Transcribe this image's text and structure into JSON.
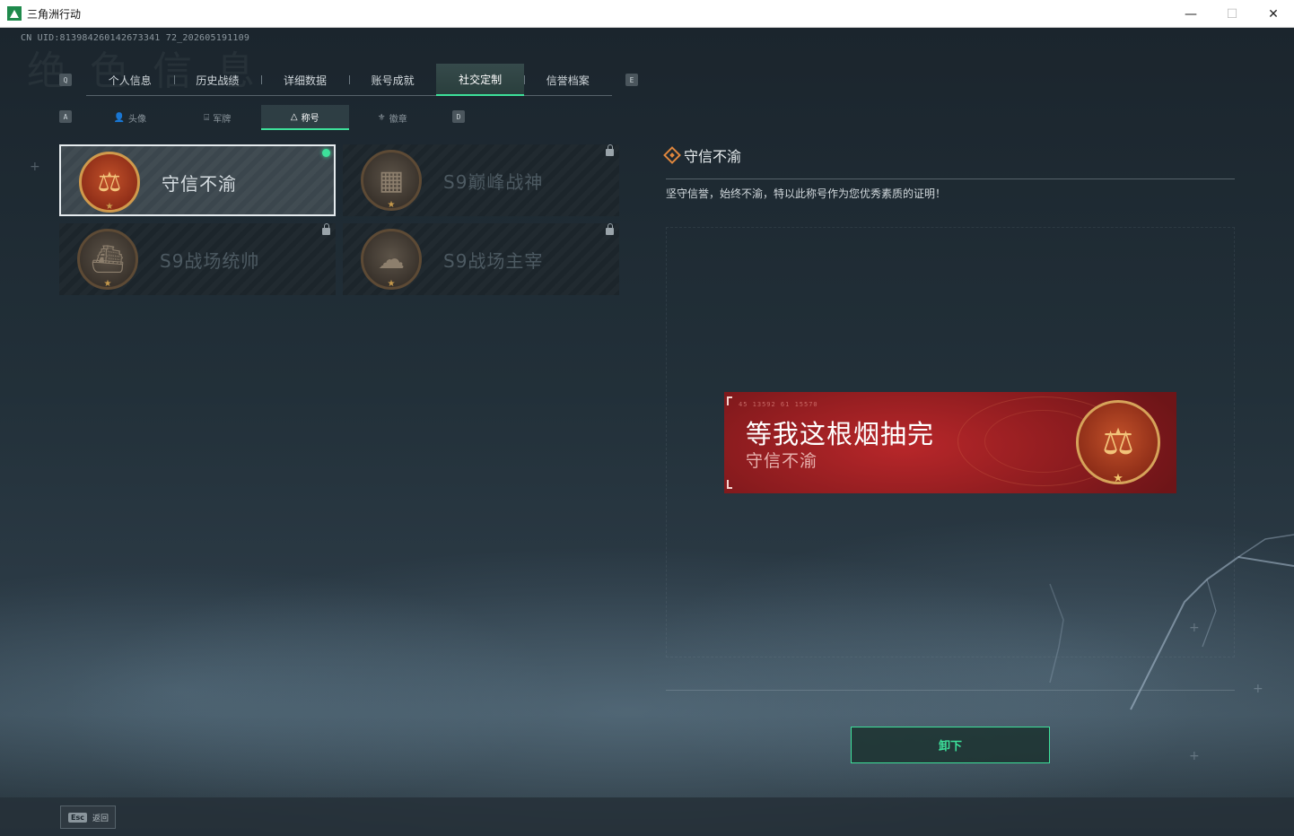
{
  "window": {
    "title": "三角洲行动",
    "minimize": "—",
    "maximize": "☐",
    "close": "✕"
  },
  "header": {
    "uid": "CN UID:813984260142673341 72_202605191109",
    "watermark": "绝 色 信 息"
  },
  "main_tabs": {
    "left_key": "Q",
    "right_key": "E",
    "items": [
      {
        "label": "个人信息"
      },
      {
        "label": "历史战绩"
      },
      {
        "label": "详细数据"
      },
      {
        "label": "账号成就"
      },
      {
        "label": "社交定制",
        "active": true
      },
      {
        "label": "信誉档案"
      }
    ]
  },
  "sub_tabs": {
    "left_key": "A",
    "right_key": "D",
    "items": [
      {
        "label": "头像",
        "icon": "person-icon",
        "glyph": "👤"
      },
      {
        "label": "军牌",
        "icon": "dogtag-icon",
        "glyph": "⌸"
      },
      {
        "label": "称号",
        "icon": "title-icon",
        "glyph": "△",
        "active": true
      },
      {
        "label": "徽章",
        "icon": "badge-icon",
        "glyph": "⚜"
      }
    ]
  },
  "titles": [
    {
      "name": "守信不渝",
      "icon": "scales-icon",
      "glyph": "⚖",
      "selected": true,
      "equipped": true,
      "locked": false
    },
    {
      "name": "S9巅峰战神",
      "icon": "fortress-icon",
      "glyph": "▦",
      "selected": false,
      "equipped": false,
      "locked": true
    },
    {
      "name": "S9战场统帅",
      "icon": "warship-icon",
      "glyph": "⛴",
      "selected": false,
      "equipped": false,
      "locked": true
    },
    {
      "name": "S9战场主宰",
      "icon": "mushroom-cloud-icon",
      "glyph": "☁",
      "selected": false,
      "equipped": false,
      "locked": true
    }
  ],
  "detail": {
    "title": "守信不渝",
    "description": "坚守信誉，始终不渝，特以此称号作为您优秀素质的证明！"
  },
  "preview": {
    "nickname": "等我这根烟抽完",
    "title": "守信不渝",
    "code_text": "45 13592   61 15570",
    "medal_glyph": "⚖",
    "colors": {
      "banner": "#a82226",
      "medal_ring": "#d6a35a"
    }
  },
  "actions": {
    "unequip_label": "卸下"
  },
  "footer": {
    "esc_key": "Esc",
    "back_label": "返回"
  },
  "colors": {
    "accent": "#3de09a",
    "title_icon": "#e0873d"
  }
}
